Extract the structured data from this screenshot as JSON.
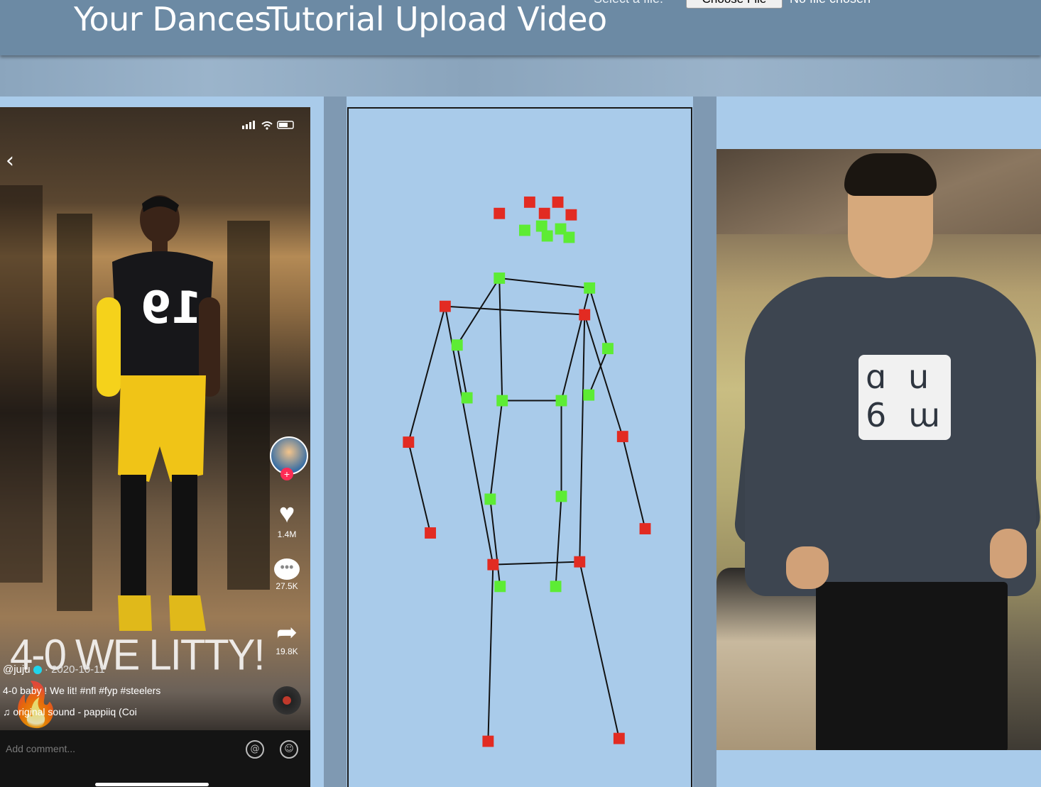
{
  "nav": {
    "links": [
      "Your Dances",
      "Tutorial",
      "Upload Video"
    ],
    "file_label": "Select a file:",
    "choose_button": "Choose File",
    "file_status": "No file chosen"
  },
  "reference_video": {
    "caption_overlay": "4-0 WE LITTY! 🔥",
    "username": "@juju",
    "date": "· 2020-10-11",
    "description": "4-0 baby ! We lit! #nfl #fyp #steelers",
    "sound": "original sound - pappiiq (Coi",
    "likes": "1.4M",
    "comments": "27.5K",
    "shares": "19.8K",
    "comment_placeholder": "Add comment...",
    "jersey_number": "19"
  },
  "skeleton": {
    "joint_colors": {
      "red": "#e22b22",
      "green": "#5dec34"
    },
    "line_color": "#111111"
  }
}
